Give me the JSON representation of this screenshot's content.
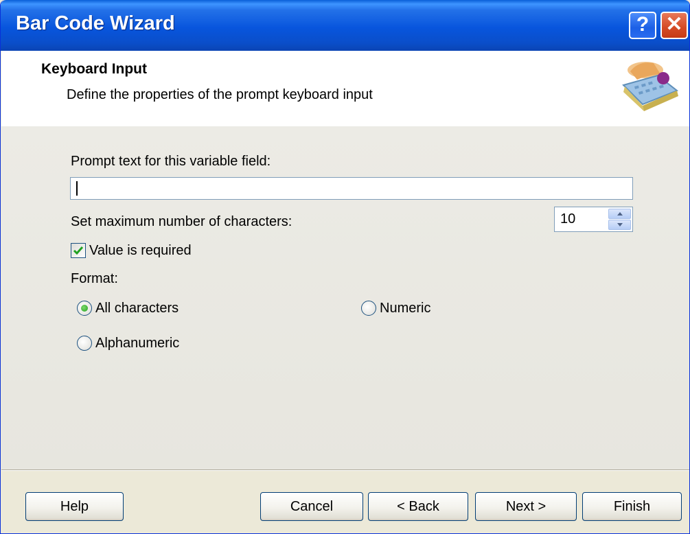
{
  "window": {
    "title": "Bar Code Wizard"
  },
  "titlebar": {
    "help_glyph": "?",
    "close_glyph": "✕"
  },
  "header": {
    "title": "Keyboard Input",
    "subtitle": "Define the properties of the prompt keyboard input",
    "icon": "keyboard-hand-icon"
  },
  "form": {
    "prompt_label": "Prompt text for this variable field:",
    "prompt_value": "",
    "max_chars_label": "Set maximum number of characters:",
    "max_chars_value": "10",
    "value_required_label": "Value is required",
    "value_required_checked": true,
    "format_label": "Format:",
    "format_options": [
      {
        "label": "All characters",
        "selected": true
      },
      {
        "label": "Numeric",
        "selected": false
      },
      {
        "label": "Alphanumeric",
        "selected": false
      }
    ]
  },
  "buttons": {
    "help": "Help",
    "cancel": "Cancel",
    "back": "< Back",
    "next": "Next >",
    "finish": "Finish"
  },
  "colors": {
    "title_bar": "#0a55dd",
    "close_button": "#d44a24",
    "radio_selected": "#21a121",
    "check_mark": "#21a121"
  }
}
